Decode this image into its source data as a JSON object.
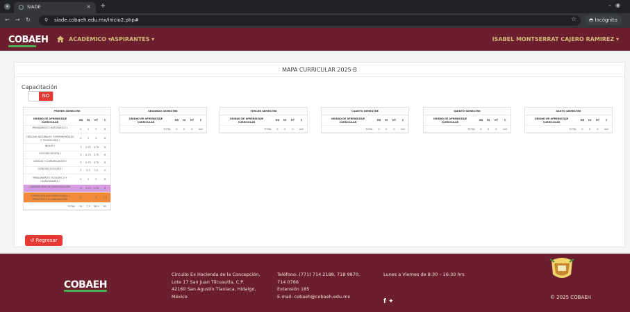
{
  "browser": {
    "tab_title": "SIADE",
    "url": "siade.cobaeh.edu.mx/inicio2.php#",
    "incognito_label": "Incógnito"
  },
  "nav": {
    "logo": "COBAEH",
    "menu": [
      "ACADÉMICO ▾",
      "ASPIRANTES ▾"
    ],
    "user": "ISABEL MONTSERRAT CAJERO RAMIREZ ▾"
  },
  "card": {
    "title": "MAPA CURRICULAR 2025-B",
    "capacitacion_label": "Capacitación",
    "toggle_value": "NO",
    "back_button": "Regresar"
  },
  "table_headers": {
    "unit": "UNIDAD DE APRENDIZAJE CURRICULAR",
    "cols": [
      "HD",
      "HI",
      "HT",
      "C"
    ],
    "total": "TOTAL"
  },
  "semesters": [
    {
      "name": "PRIMER SEMESTRE",
      "rows": [
        {
          "unit": "PENSAMIENTO MATEMÁTICO I",
          "vals": [
            "4",
            "1",
            "5",
            "8"
          ],
          "hl": ""
        },
        {
          "unit": "CIENCIAS NATURALES, EXPERIMENTALES Y TECNOLOGÍA I",
          "vals": [
            "4",
            "1",
            "5",
            "8"
          ],
          "hl": ""
        },
        {
          "unit": "INGLÉS I",
          "vals": [
            "3",
            "0.75",
            "3.75",
            "6"
          ],
          "hl": ""
        },
        {
          "unit": "CULTURA DIGITAL I",
          "vals": [
            "3",
            "0.75",
            "3.75",
            "6"
          ],
          "hl": ""
        },
        {
          "unit": "LENGUA Y COMUNICACIÓN I",
          "vals": [
            "3",
            "0.75",
            "3.75",
            "6"
          ],
          "hl": ""
        },
        {
          "unit": "CIENCIAS SOCIALES I",
          "vals": [
            "2",
            "0.5",
            "2.5",
            "4"
          ],
          "hl": ""
        },
        {
          "unit": "PENSAMIENTO FILOSÓFICO Y HUMANIDADES I",
          "vals": [
            "4",
            "1",
            "5",
            "8"
          ],
          "hl": ""
        },
        {
          "unit": "LABORATORIO DE INVESTIGACIÓN",
          "vals": [
            "3",
            "0.75",
            "3.75",
            "6"
          ],
          "hl": "purple"
        },
        {
          "unit": "FORMACIÓN SOCIOEMOCIONAL I (PRÁCTICA Y COLABORACIÓN)",
          "vals": [
            "5",
            "",
            "5",
            "7.5"
          ],
          "hl": "orange"
        }
      ],
      "total": [
        "31",
        "7.5",
        "38.5",
        "60"
      ]
    },
    {
      "name": "SEGUNDO SEMESTRE",
      "rows": [],
      "total": [
        "0",
        "0",
        "0",
        "null"
      ]
    },
    {
      "name": "TERCER SEMESTRE",
      "rows": [],
      "total": [
        "0",
        "0",
        "0",
        "null"
      ]
    },
    {
      "name": "CUARTO SEMESTRE",
      "rows": [],
      "total": [
        "0",
        "0",
        "0",
        "null"
      ]
    },
    {
      "name": "QUINTO SEMESTRE",
      "rows": [],
      "total": [
        "0",
        "0",
        "0",
        "null"
      ]
    },
    {
      "name": "SEXTO SEMESTRE",
      "rows": [],
      "total": [
        "0",
        "0",
        "0",
        "null"
      ]
    }
  ],
  "footer": {
    "logo": "COBAEH",
    "address": [
      "Circuito Ex Hacienda de la Concepción,",
      "Lote 17 San Juan Tilcuautla, C.P.",
      "42160 San Agustín Tlaxiaca, Hidalgo,",
      "México"
    ],
    "contact": [
      "Teléfono: (771) 714 2188, 718 9870,",
      "714 0766",
      "Extensión 185",
      "E-mail: cobaeh@cobaeh.edu.mx"
    ],
    "hours": "Lunes a Viernes de 8:30 – 16:30 hrs",
    "copyright": "© 2025 COBAEH"
  },
  "colors": {
    "brand": "#6b1f2e",
    "gold": "#d4b97a",
    "danger": "#e53935",
    "highlight_purple": "#d69be0",
    "highlight_orange": "#f28a3a"
  }
}
